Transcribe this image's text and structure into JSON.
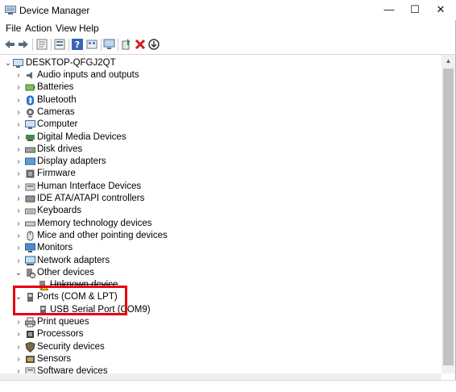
{
  "window": {
    "title": "Device Manager",
    "controls": {
      "minimize": "—",
      "maximize": "☐",
      "close": "✕"
    }
  },
  "menu": {
    "items": [
      {
        "label": "File"
      },
      {
        "label": "Action"
      },
      {
        "label": "View"
      },
      {
        "label": "Help"
      }
    ]
  },
  "toolbar": {
    "buttons": [
      {
        "icon": "back-arrow-icon"
      },
      {
        "icon": "forward-arrow-icon"
      },
      {
        "icon": "properties-icon"
      },
      {
        "icon": "list-view-icon"
      },
      {
        "icon": "help-icon"
      },
      {
        "icon": "show-hidden-icon"
      },
      {
        "icon": "scan-hardware-icon"
      },
      {
        "icon": "update-driver-icon"
      },
      {
        "icon": "uninstall-icon"
      },
      {
        "icon": "disable-device-icon"
      }
    ]
  },
  "tree": {
    "root": {
      "label": "DESKTOP-QFGJ2QT",
      "expander": "⌄"
    },
    "categories": [
      {
        "label": "Audio inputs and outputs",
        "icon": "speaker-icon",
        "expander": "›"
      },
      {
        "label": "Batteries",
        "icon": "battery-icon",
        "expander": "›"
      },
      {
        "label": "Bluetooth",
        "icon": "bluetooth-icon",
        "expander": "›"
      },
      {
        "label": "Cameras",
        "icon": "camera-icon",
        "expander": "›"
      },
      {
        "label": "Computer",
        "icon": "computer-icon",
        "expander": "›"
      },
      {
        "label": "Digital Media Devices",
        "icon": "media-device-icon",
        "expander": "›"
      },
      {
        "label": "Disk drives",
        "icon": "disk-drive-icon",
        "expander": "›"
      },
      {
        "label": "Display adapters",
        "icon": "display-adapter-icon",
        "expander": "›"
      },
      {
        "label": "Firmware",
        "icon": "firmware-icon",
        "expander": "›"
      },
      {
        "label": "Human Interface Devices",
        "icon": "hid-icon",
        "expander": "›"
      },
      {
        "label": "IDE ATA/ATAPI controllers",
        "icon": "ide-controller-icon",
        "expander": "›"
      },
      {
        "label": "Keyboards",
        "icon": "keyboard-icon",
        "expander": "›"
      },
      {
        "label": "Memory technology devices",
        "icon": "memory-icon",
        "expander": "›"
      },
      {
        "label": "Mice and other pointing devices",
        "icon": "mouse-icon",
        "expander": "›"
      },
      {
        "label": "Monitors",
        "icon": "monitor-icon",
        "expander": "›"
      },
      {
        "label": "Network adapters",
        "icon": "network-adapter-icon",
        "expander": "›"
      },
      {
        "label": "Other devices",
        "icon": "other-devices-icon",
        "expander": "⌄"
      },
      {
        "label": "Unknown device",
        "icon": "unknown-device-icon",
        "child": true
      },
      {
        "label": "Ports (COM & LPT)",
        "icon": "port-icon",
        "expander": "⌄"
      },
      {
        "label": "USB Serial Port (COM9)",
        "icon": "port-icon",
        "child": true
      },
      {
        "label": "Print queues",
        "icon": "printer-icon",
        "expander": "›"
      },
      {
        "label": "Processors",
        "icon": "processor-icon",
        "expander": "›"
      },
      {
        "label": "Security devices",
        "icon": "security-icon",
        "expander": "›"
      },
      {
        "label": "Sensors",
        "icon": "sensor-icon",
        "expander": "›"
      },
      {
        "label": "Software devices",
        "icon": "software-device-icon",
        "expander": "›"
      }
    ]
  },
  "scrollbar": {
    "up_arrow": "▲"
  },
  "colors": {
    "highlight_border": "#e60012",
    "scroll_thumb": "#c2c2c2"
  }
}
